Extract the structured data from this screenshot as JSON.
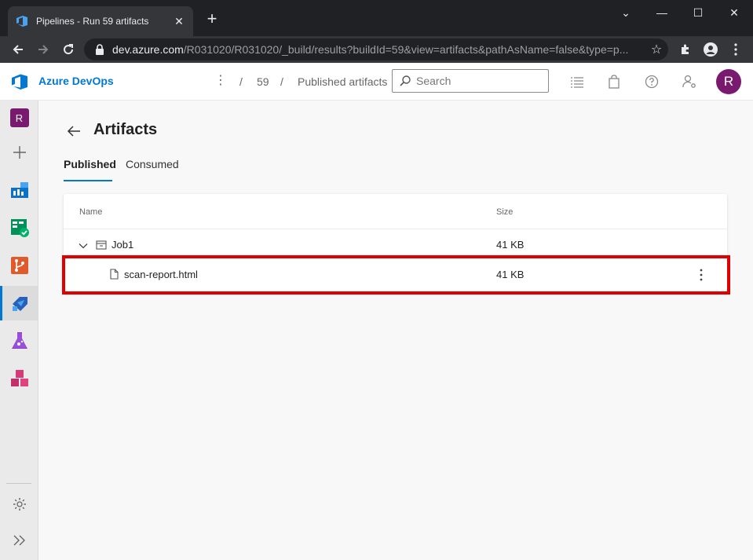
{
  "browser": {
    "tab_title": "Pipelines - Run 59 artifacts",
    "tab_close": "✕",
    "new_tab": "+",
    "url_host": "dev.azure.com",
    "url_path": "/R031020/R031020/_build/results?buildId=59&view=artifacts&pathAsName=false&type=p...",
    "window_controls": {
      "minimize": "—",
      "maximize": "☐",
      "close": "✕",
      "menu": "⌄"
    }
  },
  "header": {
    "brand": "Azure DevOps",
    "breadcrumb": [
      {
        "label": "59"
      },
      {
        "label": "Published artifacts"
      }
    ],
    "separator": "/",
    "search_placeholder": "Search",
    "avatar_initial": "R"
  },
  "leftnav": {
    "project_initial": "R",
    "items": [
      "project",
      "add",
      "overview",
      "boards",
      "repos",
      "pipelines",
      "test-plans",
      "artifacts"
    ],
    "active": "pipelines"
  },
  "page": {
    "title": "Artifacts",
    "tabs": [
      {
        "label": "Published",
        "active": true
      },
      {
        "label": "Consumed",
        "active": false
      }
    ]
  },
  "table": {
    "columns": {
      "name": "Name",
      "size": "Size"
    },
    "rows": [
      {
        "name": "Job1",
        "size": "41 KB",
        "type": "folder",
        "expanded": true
      },
      {
        "name": "scan-report.html",
        "size": "41 KB",
        "type": "file"
      }
    ]
  },
  "colors": {
    "accent": "#0078d4",
    "avatar": "#7a1a6e",
    "highlight": "#e00000"
  }
}
